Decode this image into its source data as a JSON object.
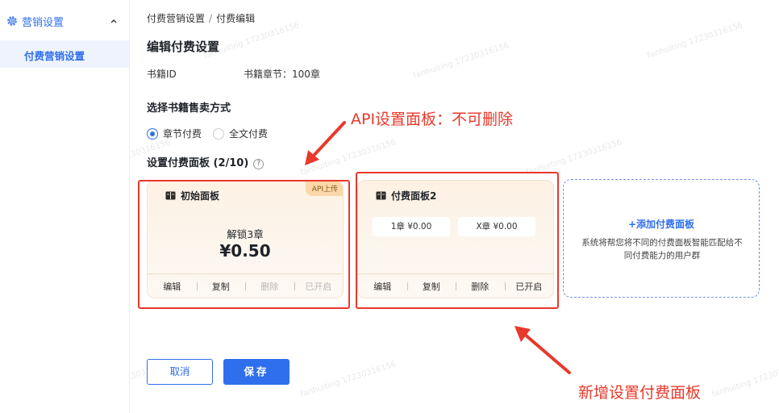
{
  "sidebar": {
    "group_label": "营销设置",
    "item_label": "付费营销设置"
  },
  "breadcrumb": {
    "parent": "付费营销设置",
    "separator": "/",
    "current": "付费编辑"
  },
  "page_title": "编辑付费设置",
  "book_info": {
    "book_id_label": "书籍ID",
    "chapters_label": "书籍章节：100章"
  },
  "sale_mode": {
    "title": "选择书籍售卖方式",
    "options": [
      {
        "label": "章节付费",
        "selected": true
      },
      {
        "label": "全文付费",
        "selected": false
      }
    ]
  },
  "panels_section": {
    "title": "设置付费面板 (2/10)",
    "help_glyph": "?"
  },
  "panels": {
    "initial": {
      "title": "初始面板",
      "tag": "API上传",
      "unlock_text": "解锁3章",
      "price": "¥0.50",
      "actions": [
        "编辑",
        "复制",
        "删除",
        "已开启"
      ]
    },
    "paid2": {
      "title": "付费面板2",
      "tiers": [
        "1章 ¥0.00",
        "X章 ¥0.00"
      ],
      "actions": [
        "编辑",
        "复制",
        "删除",
        "已开启"
      ]
    },
    "add": {
      "title": "+添加付费面板",
      "description": "系统将帮您将不同的付费面板智能匹配给不同付费能力的用户群"
    }
  },
  "buttons": {
    "cancel": "取消",
    "save": "保存"
  },
  "annotations": {
    "top": "API设置面板：不可删除",
    "bottom": "新增设置付费面板"
  },
  "watermark_text": "fanhuiting 17230316156",
  "colors": {
    "accent": "#2f6fed",
    "annotation_red": "#e8392c",
    "panel_bg": "#fdf1e3",
    "api_tag_bg": "#fbd8a9"
  }
}
